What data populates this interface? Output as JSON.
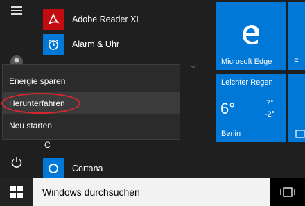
{
  "start_menu": {
    "top_hint": "",
    "apps": [
      {
        "label": "Adobe Reader XI",
        "icon": "adobe-reader-icon"
      },
      {
        "label": "Alarm & Uhr",
        "icon": "alarm-clock-icon"
      }
    ],
    "group_letter": "C",
    "cortana": {
      "label": "Cortana",
      "icon": "cortana-icon"
    }
  },
  "tiles": {
    "edge": {
      "label": "Microsoft Edge",
      "color": "#0078d7"
    },
    "weather": {
      "condition": "Leichter Regen",
      "temperature": "6°",
      "high": "7°",
      "low": "-2°",
      "city": "Berlin",
      "color": "#0078d7"
    }
  },
  "power_menu": {
    "items": [
      {
        "label": "Energie sparen"
      },
      {
        "label": "Herunterfahren",
        "highlighted": true
      },
      {
        "label": "Neu starten"
      }
    ],
    "annotation_color": "#d9272e"
  },
  "taskbar": {
    "search_placeholder": "Windows durchsuchen"
  }
}
